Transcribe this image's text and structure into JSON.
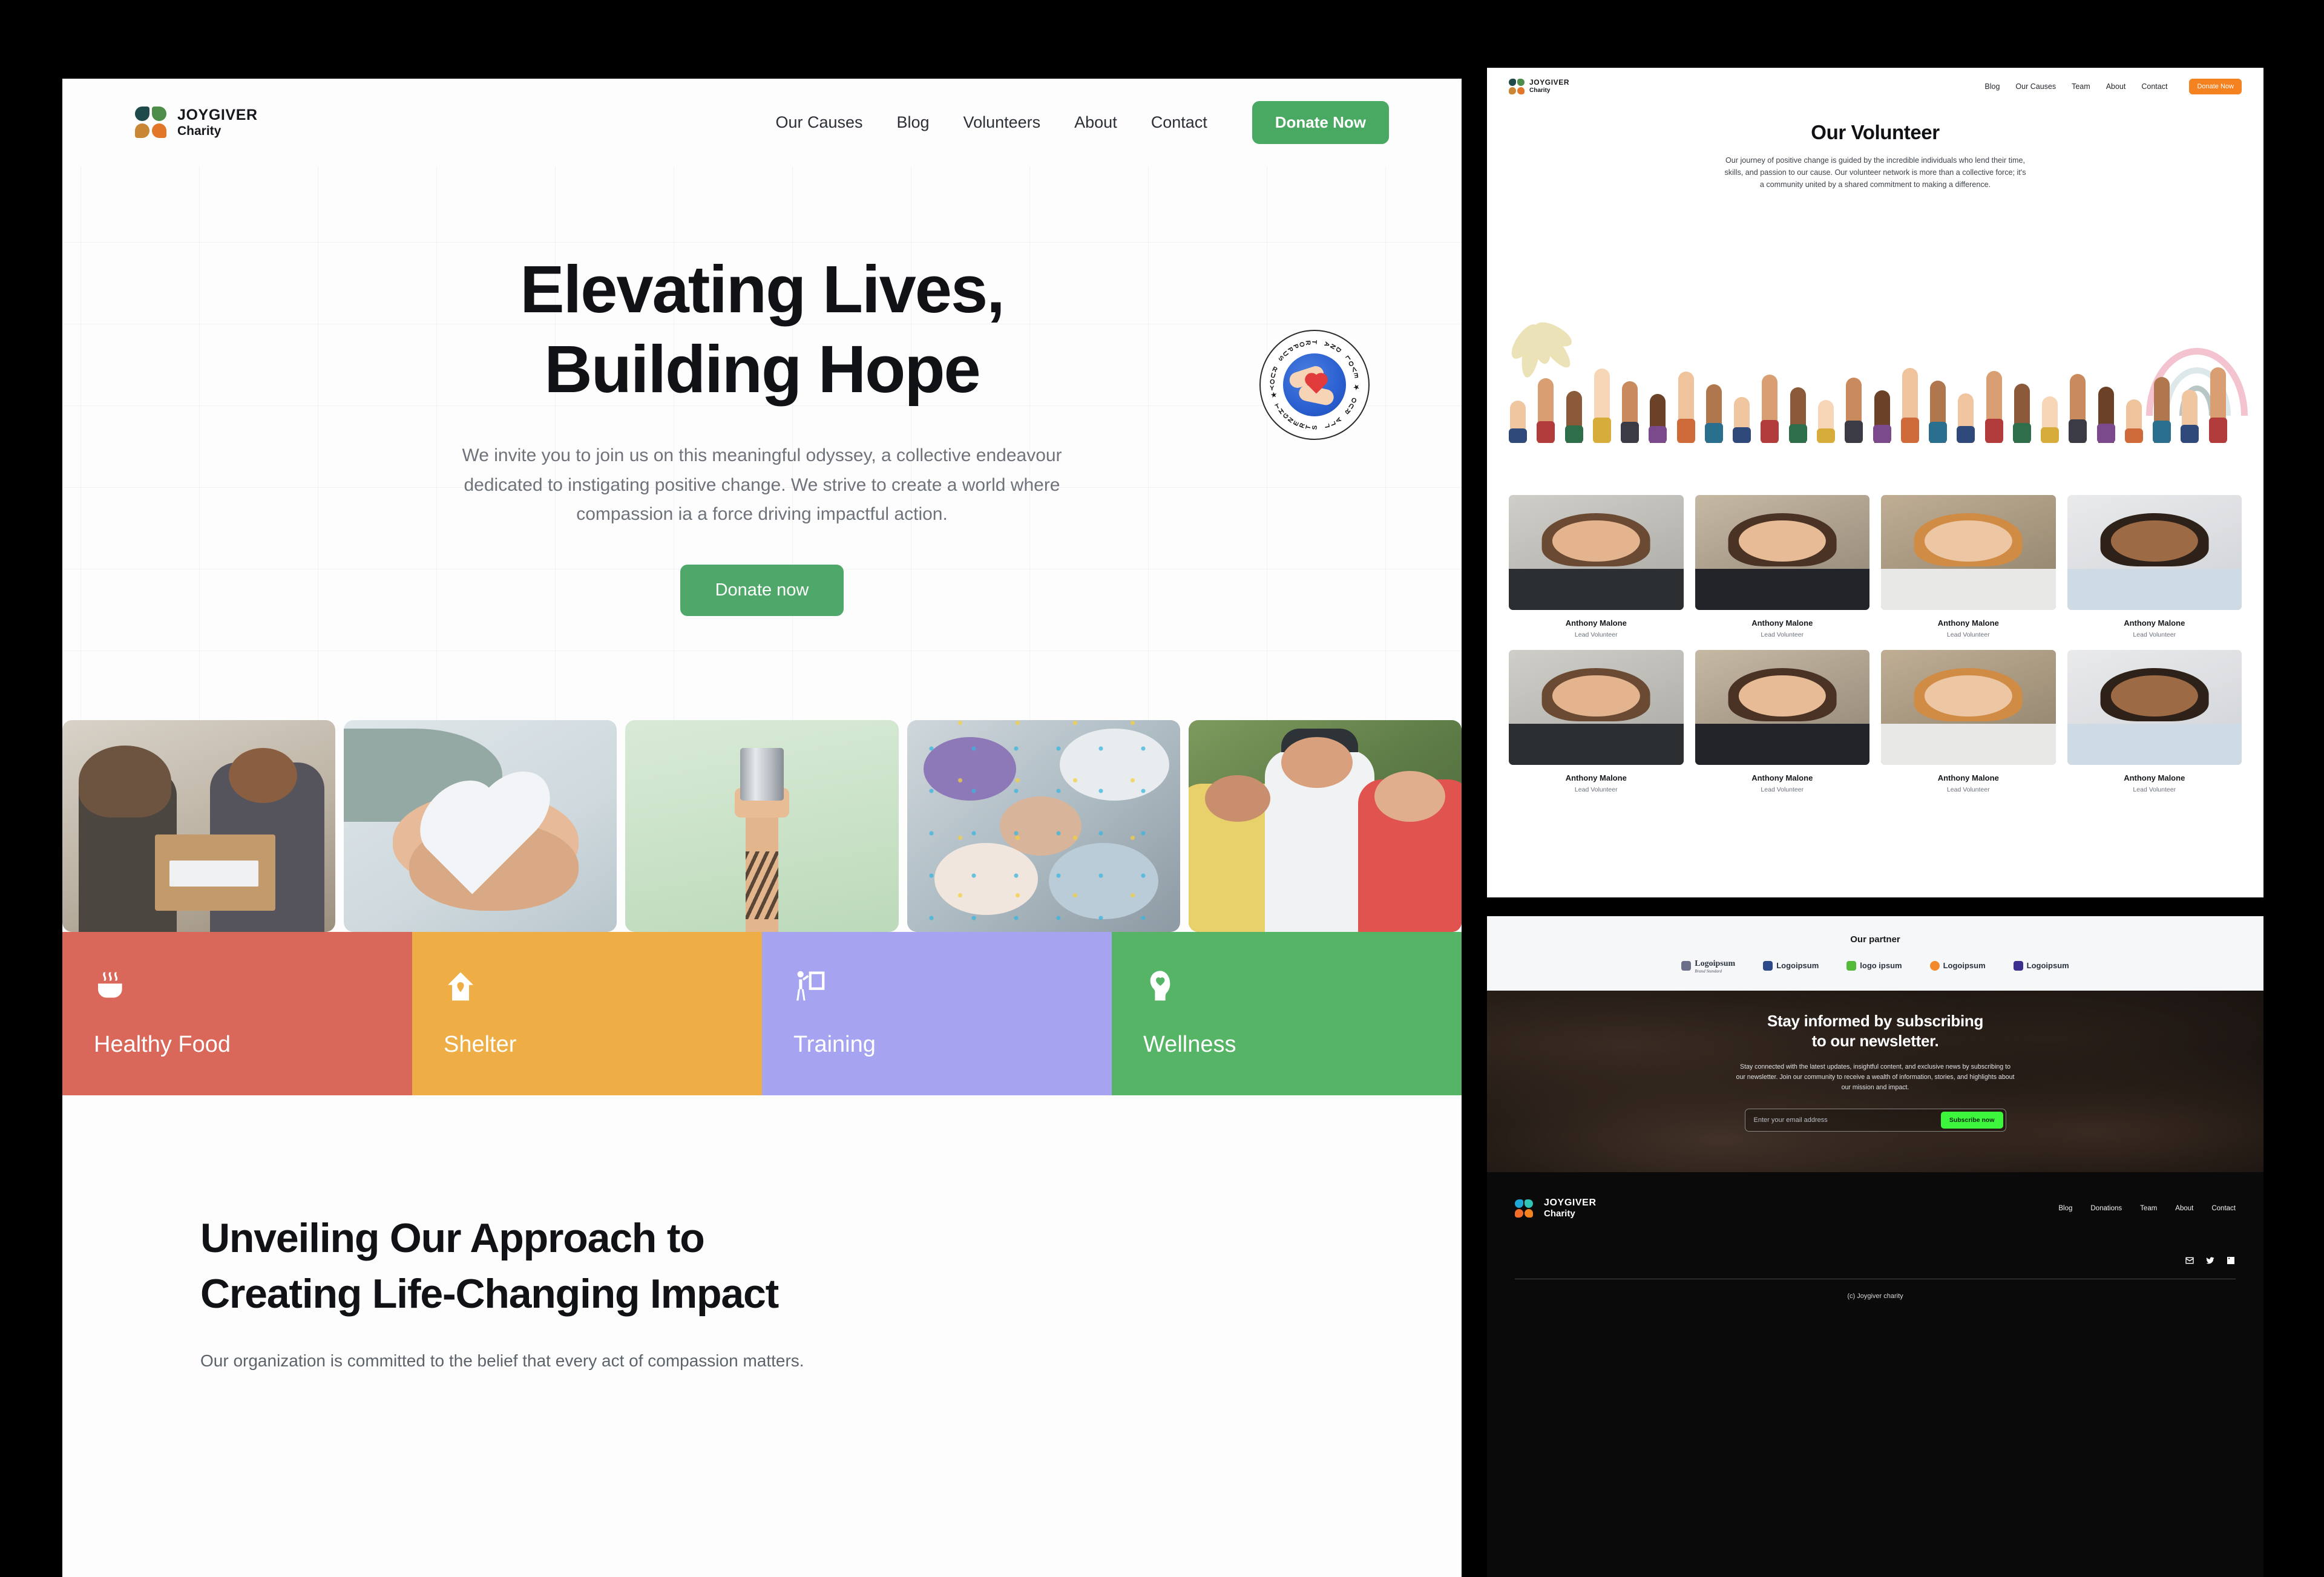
{
  "brand": {
    "line1": "JOYGIVER",
    "line2": "Charity"
  },
  "home": {
    "nav": {
      "links": [
        "Our Causes",
        "Blog",
        "Volunteers",
        "About",
        "Contact"
      ],
      "cta": "Donate Now"
    },
    "hero": {
      "title_line1": "Elevating Lives,",
      "title_line2": "Building Hope",
      "paragraph": "We invite you to join us on this meaningful odyssey, a collective endeavour dedicated to instigating positive change. We strive to create a world where compassion ia a force driving impactful action.",
      "cta": "Donate now",
      "seal_text": "YOUR SUPPORT AND LOVE ★ OUR ALL STRENGHT ★",
      "gallery": [
        {
          "name": "donation-box-handoff"
        },
        {
          "name": "hands-holding-paper-heart"
        },
        {
          "name": "hand-holding-food-can"
        },
        {
          "name": "friends-lying-in-circle"
        },
        {
          "name": "friends-group-selfie"
        }
      ]
    },
    "causes": [
      {
        "label": "Healthy Food",
        "icon": "bowl-steam-icon",
        "color": "#d9675a"
      },
      {
        "label": "Shelter",
        "icon": "house-icon",
        "color": "#eeae45"
      },
      {
        "label": "Training",
        "icon": "presenter-icon",
        "color": "#a6a4f0"
      },
      {
        "label": "Wellness",
        "icon": "head-heart-icon",
        "color": "#55b465"
      }
    ],
    "approach": {
      "heading_line1": "Unveiling Our Approach to",
      "heading_line2": "Creating Life-Changing Impact",
      "body": "Our organization is committed to the belief that every act of compassion matters."
    }
  },
  "volunteer_page": {
    "nav": {
      "links": [
        "Blog",
        "Our Causes",
        "Team",
        "About",
        "Contact"
      ],
      "cta": "Donate Now"
    },
    "heading": "Our Volunteer",
    "intro": "Our journey of positive change is guided by the incredible individuals who lend their time, skills, and passion to our cause. Our volunteer network is more than a collective force; it's a community united by a shared commitment to making a difference.",
    "hero_image": "raised-hands-photo",
    "decorations": [
      "leaf-splash-decoration",
      "rainbow-arcs-decoration"
    ],
    "volunteers": [
      {
        "name": "Anthony Malone",
        "role": "Lead Volunteer"
      },
      {
        "name": "Anthony Malone",
        "role": "Lead Volunteer"
      },
      {
        "name": "Anthony Malone",
        "role": "Lead Volunteer"
      },
      {
        "name": "Anthony Malone",
        "role": "Lead Volunteer"
      },
      {
        "name": "Anthony Malone",
        "role": "Lead Volunteer"
      },
      {
        "name": "Anthony Malone",
        "role": "Lead Volunteer"
      },
      {
        "name": "Anthony Malone",
        "role": "Lead Volunteer"
      },
      {
        "name": "Anthony Malone",
        "role": "Lead Volunteer"
      }
    ]
  },
  "partners": {
    "heading": "Our partner",
    "logos": [
      {
        "name": "Logoipsum",
        "tagline": "Brand Standard",
        "mark": "circle-stack-icon",
        "color": "#6b6f8a"
      },
      {
        "name": "Logoipsum",
        "tagline": "",
        "mark": "petal-flower-icon",
        "color": "#2c4a8a"
      },
      {
        "name": "logo ipsum",
        "tagline": "",
        "mark": "bear-shield-icon",
        "color": "#55b93a"
      },
      {
        "name": "Logoipsum",
        "tagline": "",
        "mark": "sunburst-icon",
        "color": "#f08a2c"
      },
      {
        "name": "Logoipsum",
        "tagline": "",
        "mark": "hex-shield-icon",
        "color": "#3b2f8f"
      }
    ]
  },
  "newsletter": {
    "title_line1": "Stay informed by subscribing",
    "title_line2": "to our newsletter.",
    "body": "Stay connected with the latest updates, insightful content, and exclusive news by subscribing to our newsletter. Join our community to receive a wealth of information, stories, and highlights about our mission and impact.",
    "email_placeholder": "Enter your email address",
    "email_value": "",
    "cta": "Subscribe now",
    "cta_color": "#3ef53e",
    "background_image": "children-lying-in-circle-photo"
  },
  "footer": {
    "links": [
      "Blog",
      "Donations",
      "Team",
      "About",
      "Contact"
    ],
    "social": [
      "email-icon",
      "twitter-icon",
      "linkedin-icon"
    ],
    "copyright": "(c) Joygiver charity"
  }
}
